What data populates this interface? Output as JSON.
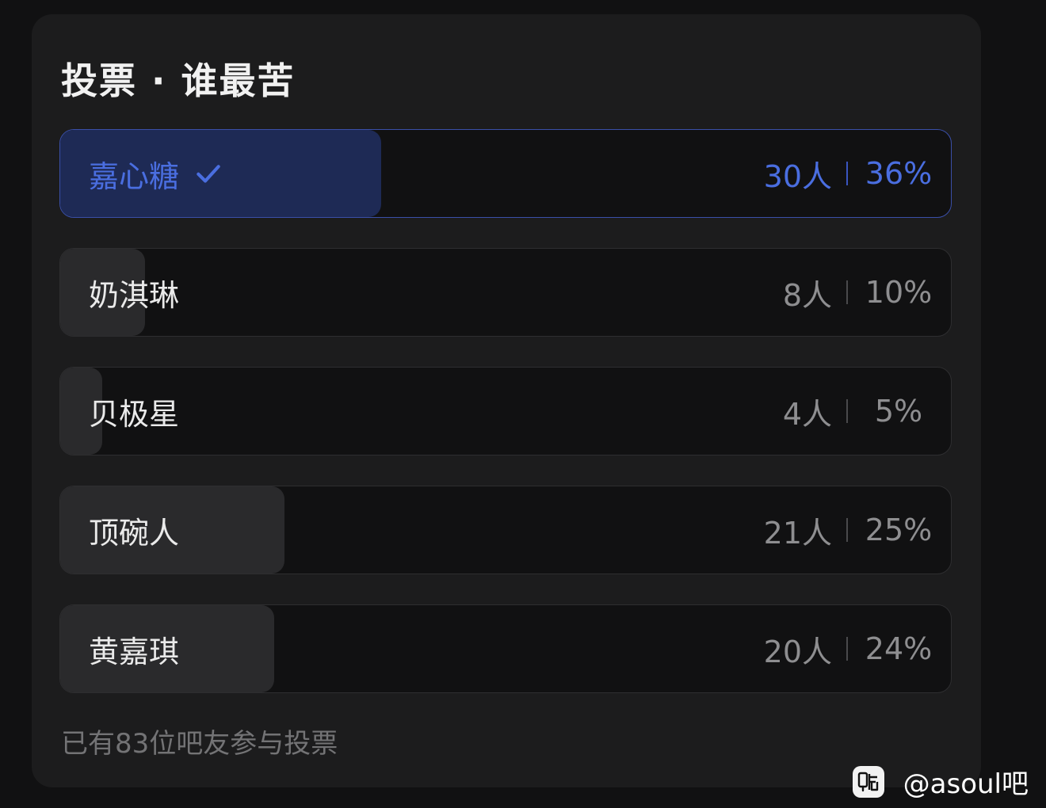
{
  "poll": {
    "title": "投票 · 谁最苦",
    "options": [
      {
        "label": "嘉心糖",
        "count": "30人",
        "percent": "36%",
        "fraction": 0.36,
        "selected": true
      },
      {
        "label": "奶淇琳",
        "count": "8人",
        "percent": "10%",
        "fraction": 0.095,
        "selected": false
      },
      {
        "label": "贝极星",
        "count": "4人",
        "percent": "5%",
        "fraction": 0.047,
        "selected": false
      },
      {
        "label": "顶碗人",
        "count": "21人",
        "percent": "25%",
        "fraction": 0.252,
        "selected": false
      },
      {
        "label": "黄嘉琪",
        "count": "20人",
        "percent": "24%",
        "fraction": 0.24,
        "selected": false
      }
    ],
    "footer": "已有83位吧友参与投票"
  },
  "watermark": {
    "text": "@asoul吧",
    "icon": "tieba-icon"
  },
  "colors": {
    "accent": "#4a6ee0",
    "selected_fill": "#1e2a55",
    "option_fill": "#2a2a2c",
    "card_bg": "#1c1c1d",
    "page_bg": "#111112"
  }
}
